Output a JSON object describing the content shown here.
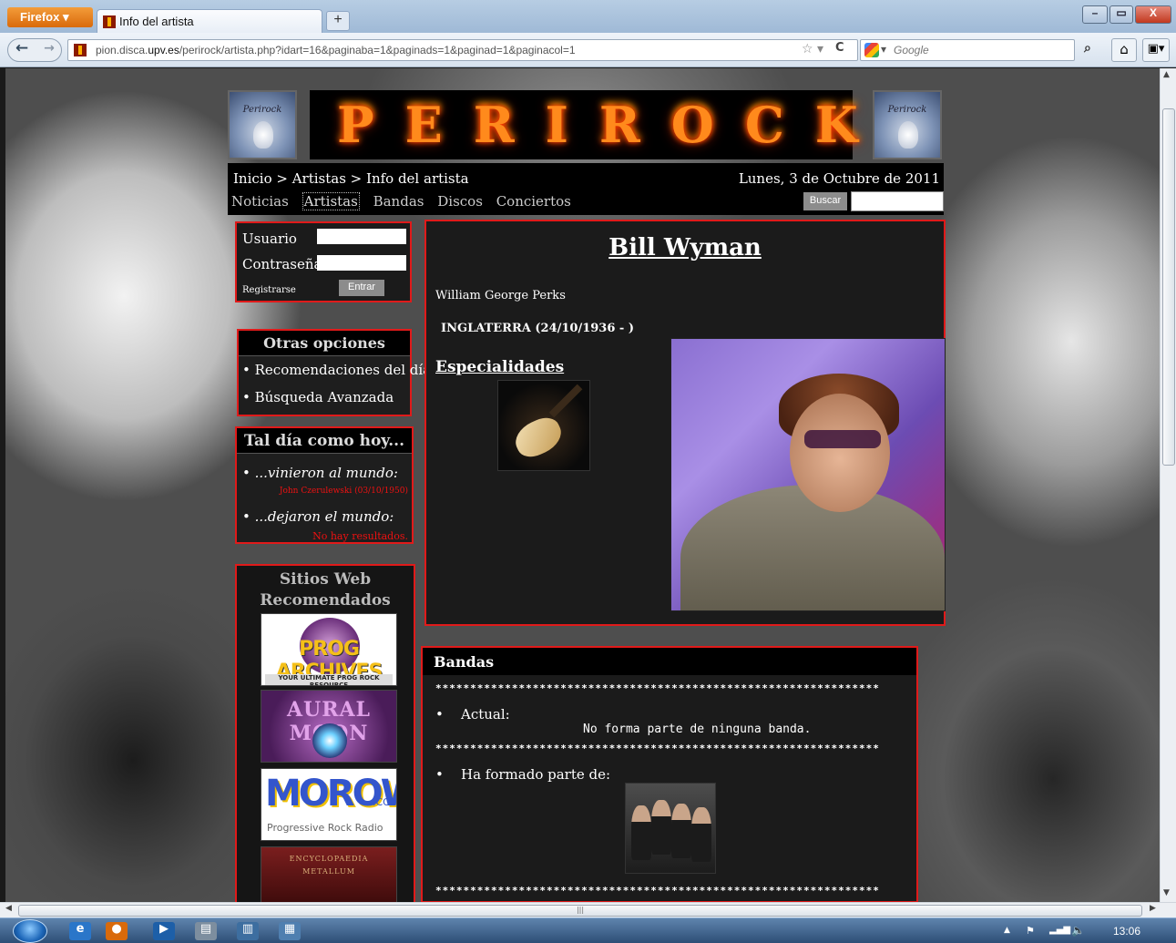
{
  "browser": {
    "menu_label": "Firefox",
    "tab_title": "Info del artista",
    "new_tab": "+",
    "url_prefix": "pion.disca.",
    "url_host": "upv.es",
    "url_path": "/perirock/artista.php?idart=16&paginaba=1&paginads=1&paginad=1&paginacol=1",
    "search_placeholder": "Google",
    "win_min": "–",
    "win_max": "▭",
    "win_close": "X"
  },
  "site": {
    "logo_left_text": "Perirock",
    "logo_right_text": "Perirock",
    "banner": "PERIROCK",
    "breadcrumb": "Inicio > Artistas > Info del artista",
    "date": "Lunes, 3 de Octubre de 2011",
    "nav": [
      "Noticias",
      "Artistas",
      "Bandas",
      "Discos",
      "Conciertos"
    ],
    "search_button": "Buscar",
    "accent_color": "#e01a1a"
  },
  "login": {
    "user_label": "Usuario",
    "pass_label": "Contraseña",
    "register": "Registrarse",
    "submit": "Entrar"
  },
  "otras": {
    "title": "Otras opciones",
    "items": [
      "Recomendaciones del día",
      "Búsqueda Avanzada"
    ]
  },
  "taldia": {
    "title": "Tal día como hoy...",
    "born_label": "...vinieron al mundo:",
    "born_value": "John Czerulewski (03/10/1950)",
    "died_label": "...dejaron el mundo:",
    "died_value": "No hay resultados."
  },
  "sitios": {
    "title": "Sitios Web Recomendados",
    "sites": [
      {
        "text": "PROG ARCHIVES",
        "tag": "YOUR ULTIMATE PROG ROCK RESOURCE"
      },
      {
        "text": "AURAL MOON"
      },
      {
        "text": "MOROW",
        "suffix": ".COM",
        "tag": "Progressive Rock Radio"
      },
      {
        "text": "ENCYCLOPAEDIA METALLUM"
      }
    ]
  },
  "artist": {
    "name": "Bill Wyman",
    "real_name": "William George Perks",
    "origin": "INGLATERRA (24/10/1936 - )",
    "specialties_title": "Especialidades"
  },
  "bandas": {
    "title": "Bandas",
    "stars": "****************************************************************",
    "current_label": "Actual:",
    "current_value": "No forma parte de ninguna banda.",
    "past_label": "Ha formado parte de:"
  },
  "taskbar": {
    "clock": "13:06"
  }
}
